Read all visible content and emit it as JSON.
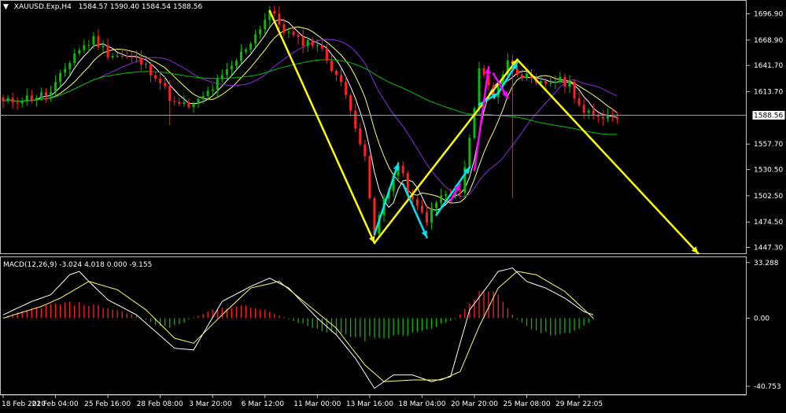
{
  "header": {
    "arrow": "▼",
    "symbol": "XAUUSD.Exp,H4",
    "ohlc": "1584.57 1590.40 1584.54 1588.56"
  },
  "macd_header": "MACD(12,26,9) -3.024 4.018 0.000 -9.155",
  "colors": {
    "background": "#000000",
    "frame": "#c0c0c0",
    "bull": "#00c000",
    "bear": "#ff2020",
    "ma_white": "#ffffff",
    "ma_yellow": "#ffff66",
    "ma_violet": "#8a2be2",
    "ma_green": "#00c000",
    "zigzag": "#ffff00",
    "wave_cyan": "#00e5ee",
    "wave_magenta": "#ff00ff",
    "macd_line": "#ffffff",
    "signal_line": "#ffff66"
  },
  "chart_data": [
    {
      "type": "candlestick",
      "title": "",
      "current_price": 1588.56,
      "current_price_label": "1588.56",
      "ylim": [
        1441,
        1710
      ],
      "y_ticks": [
        {
          "value": 1696.9,
          "label": "1696.90"
        },
        {
          "value": 1668.9,
          "label": "1668.90"
        },
        {
          "value": 1641.7,
          "label": "1641.70"
        },
        {
          "value": 1613.7,
          "label": "1613.70"
        },
        {
          "value": 1557.7,
          "label": "1557.70"
        },
        {
          "value": 1530.5,
          "label": "1530.50"
        },
        {
          "value": 1502.5,
          "label": "1502.50"
        },
        {
          "value": 1474.5,
          "label": "1474.50"
        },
        {
          "value": 1447.3,
          "label": "1447.30"
        }
      ],
      "x_ticks": [
        {
          "i": 0,
          "label": "18 Feb 2020"
        },
        {
          "i": 11,
          "label": "21 Feb 04:00"
        },
        {
          "i": 22,
          "label": "25 Feb 16:00"
        },
        {
          "i": 33,
          "label": "28 Feb 08:00"
        },
        {
          "i": 44,
          "label": "3 Mar 20:00"
        },
        {
          "i": 55,
          "label": "6 Mar 12:00"
        },
        {
          "i": 66,
          "label": "11 Mar 00:00"
        },
        {
          "i": 77,
          "label": "13 Mar 16:00"
        },
        {
          "i": 88,
          "label": "18 Mar 04:00"
        },
        {
          "i": 99,
          "label": "20 Mar 20:00"
        },
        {
          "i": 110,
          "label": "25 Mar 08:00"
        },
        {
          "i": 121,
          "label": "29 Mar 22:05"
        }
      ],
      "bar_count": 130,
      "close_path": [
        [
          0,
          1602
        ],
        [
          6,
          1608
        ],
        [
          10,
          1612
        ],
        [
          15,
          1655
        ],
        [
          19,
          1670
        ],
        [
          22,
          1655
        ],
        [
          28,
          1648
        ],
        [
          32,
          1632
        ],
        [
          36,
          1600
        ],
        [
          40,
          1598
        ],
        [
          44,
          1618
        ],
        [
          48,
          1640
        ],
        [
          53,
          1675
        ],
        [
          56,
          1700
        ],
        [
          59,
          1680
        ],
        [
          62,
          1668
        ],
        [
          66,
          1665
        ],
        [
          70,
          1632
        ],
        [
          73,
          1598
        ],
        [
          76,
          1540
        ],
        [
          78,
          1460
        ],
        [
          80,
          1500
        ],
        [
          83,
          1535
        ],
        [
          86,
          1495
        ],
        [
          89,
          1478
        ],
        [
          92,
          1502
        ],
        [
          96,
          1505
        ],
        [
          98,
          1560
        ],
        [
          100,
          1640
        ],
        [
          103,
          1610
        ],
        [
          106,
          1645
        ],
        [
          109,
          1632
        ],
        [
          112,
          1620
        ],
        [
          116,
          1626
        ],
        [
          119,
          1622
        ],
        [
          122,
          1590
        ],
        [
          124,
          1588.56
        ]
      ],
      "spikes": [
        {
          "i": 107,
          "low": 1500
        },
        {
          "i": 35,
          "low": 1578
        }
      ],
      "zigzag": [
        [
          78,
          1452
        ],
        [
          108,
          1648
        ],
        [
          146,
          1440
        ],
        [
          56,
          1700
        ],
        [
          78,
          1452
        ]
      ],
      "zigzag_order": "legs",
      "zigzag_legs": [
        [
          [
            56,
            1700
          ],
          [
            78,
            1452
          ]
        ],
        [
          [
            78,
            1452
          ],
          [
            108,
            1648
          ]
        ],
        [
          [
            108,
            1648
          ],
          [
            146,
            1441
          ]
        ]
      ],
      "cyan_arrows": [
        [
          [
            78,
            1461
          ],
          [
            83,
            1537
          ]
        ],
        [
          [
            84,
            1515
          ],
          [
            89,
            1458
          ]
        ],
        [
          [
            91,
            1482
          ],
          [
            98,
            1533
          ]
        ],
        [
          [
            100,
            1600
          ],
          [
            104,
            1612
          ]
        ],
        [
          [
            104,
            1612
          ],
          [
            108,
            1645
          ]
        ]
      ],
      "magenta_arrows": [
        [
          [
            94,
            1497
          ],
          [
            96,
            1515
          ]
        ],
        [
          [
            99,
            1530
          ],
          [
            102,
            1640
          ]
        ],
        [
          [
            103,
            1633
          ],
          [
            106,
            1607
          ]
        ]
      ]
    },
    {
      "type": "macd",
      "title": "",
      "ylim": [
        -45,
        36
      ],
      "y_ticks": [
        {
          "value": 33.288,
          "label": "33.288"
        },
        {
          "value": 0,
          "label": "0.00"
        },
        {
          "value": -40.753,
          "label": "-40.753"
        }
      ],
      "macd_path": [
        [
          0,
          2
        ],
        [
          6,
          10
        ],
        [
          10,
          14
        ],
        [
          14,
          26
        ],
        [
          16,
          28
        ],
        [
          18,
          22
        ],
        [
          22,
          11
        ],
        [
          28,
          2
        ],
        [
          32,
          -8
        ],
        [
          36,
          -18
        ],
        [
          40,
          -19
        ],
        [
          46,
          10
        ],
        [
          52,
          19
        ],
        [
          56,
          24
        ],
        [
          60,
          18
        ],
        [
          66,
          0
        ],
        [
          70,
          -10
        ],
        [
          74,
          -24
        ],
        [
          78,
          -42
        ],
        [
          82,
          -34
        ],
        [
          86,
          -34
        ],
        [
          90,
          -38
        ],
        [
          94,
          -35
        ],
        [
          98,
          5
        ],
        [
          102,
          20
        ],
        [
          104,
          28
        ],
        [
          107,
          30
        ],
        [
          110,
          22
        ],
        [
          114,
          18
        ],
        [
          118,
          12
        ],
        [
          122,
          4
        ],
        [
          124,
          2
        ]
      ],
      "signal_path": [
        [
          0,
          0
        ],
        [
          8,
          7
        ],
        [
          12,
          12
        ],
        [
          18,
          22
        ],
        [
          24,
          17
        ],
        [
          30,
          5
        ],
        [
          36,
          -12
        ],
        [
          40,
          -15
        ],
        [
          46,
          2
        ],
        [
          52,
          18
        ],
        [
          58,
          22
        ],
        [
          64,
          8
        ],
        [
          70,
          -6
        ],
        [
          76,
          -28
        ],
        [
          80,
          -38
        ],
        [
          86,
          -37
        ],
        [
          92,
          -37
        ],
        [
          96,
          -32
        ],
        [
          100,
          -5
        ],
        [
          104,
          18
        ],
        [
          108,
          28
        ],
        [
          112,
          26
        ],
        [
          118,
          16
        ],
        [
          124,
          0
        ]
      ],
      "histogram": [
        {
          "start": 0,
          "end": 30,
          "sign": 1,
          "peak": 10
        },
        {
          "start": 30,
          "end": 40,
          "sign": -1,
          "peak": -6
        },
        {
          "start": 40,
          "end": 60,
          "sign": 1,
          "peak": 8
        },
        {
          "start": 60,
          "end": 96,
          "sign": -1,
          "peak": -14
        },
        {
          "start": 96,
          "end": 108,
          "sign": 1,
          "peak": 18
        },
        {
          "start": 108,
          "end": 125,
          "sign": -1,
          "peak": -11
        }
      ]
    }
  ]
}
